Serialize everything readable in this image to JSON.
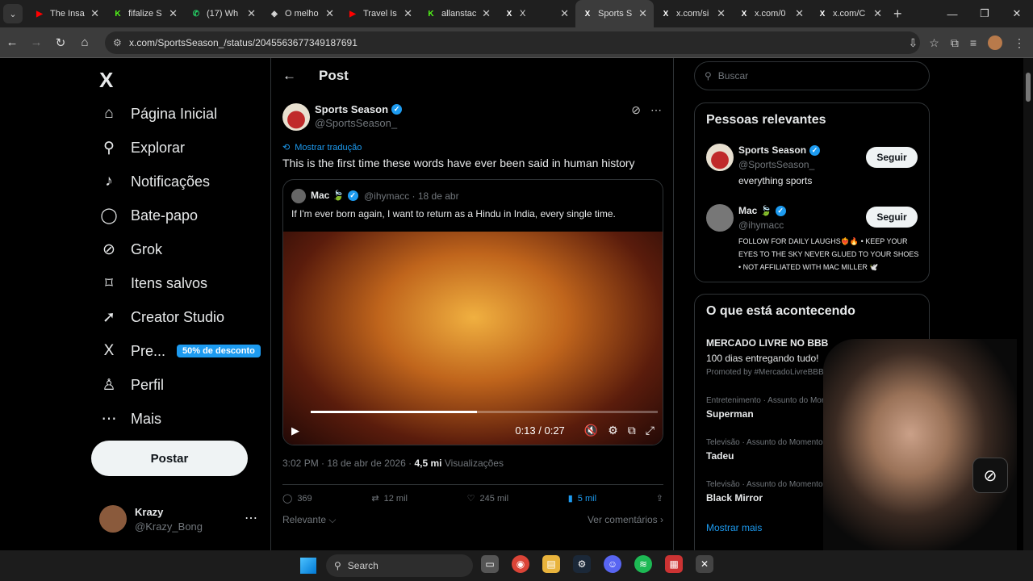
{
  "browser": {
    "tabs": [
      {
        "label": "The Insa",
        "fav": "▶",
        "color": "#ff0000"
      },
      {
        "label": "fifalize S",
        "fav": "K",
        "color": "#53fc18"
      },
      {
        "label": "(17) Wh",
        "fav": "✆",
        "color": "#25d366"
      },
      {
        "label": "O melho",
        "fav": "◈",
        "color": "#dddddd"
      },
      {
        "label": "Travel Is",
        "fav": "▶",
        "color": "#ff0000"
      },
      {
        "label": "allanstac",
        "fav": "K",
        "color": "#53fc18"
      },
      {
        "label": "X",
        "fav": "X",
        "color": "#ffffff"
      },
      {
        "label": "Sports S",
        "fav": "X",
        "color": "#ffffff"
      },
      {
        "label": "x.com/si",
        "fav": "X",
        "color": "#ffffff"
      },
      {
        "label": "x.com/0",
        "fav": "X",
        "color": "#ffffff"
      },
      {
        "label": "x.com/C",
        "fav": "X",
        "color": "#ffffff"
      }
    ],
    "url": "x.com/SportsSeason_/status/2045563677349187691"
  },
  "sidebar": {
    "logo": "X",
    "items": [
      {
        "label": "Página Inicial",
        "icon": "⌂"
      },
      {
        "label": "Explorar",
        "icon": "⚲"
      },
      {
        "label": "Notificações",
        "icon": "♪"
      },
      {
        "label": "Bate-papo",
        "icon": "◯"
      },
      {
        "label": "Grok",
        "icon": "⊘"
      },
      {
        "label": "Itens salvos",
        "icon": "⌑"
      },
      {
        "label": "Creator Studio",
        "icon": "➚"
      },
      {
        "label": "Pre...",
        "icon": "X"
      },
      {
        "label": "Perfil",
        "icon": "♙"
      },
      {
        "label": "Mais",
        "icon": "⋯"
      }
    ],
    "premium_badge": "50% de desconto",
    "post_button": "Postar",
    "user": {
      "name": "Krazy",
      "handle": "@Krazy_Bong"
    }
  },
  "main": {
    "header": "Post",
    "author": {
      "name": "Sports Season",
      "handle": "@SportsSeason_"
    },
    "translate_label": "Mostrar tradução",
    "text": "This is the first time these words have ever been said in human history",
    "quote": {
      "name": "Mac 🍃",
      "handle": "@ihymacc · 18 de abr",
      "text": "If I'm ever born again, I want to return as a Hindu in India, every single time.",
      "video_time": "0:13 / 0:27",
      "video_progress": 0.48
    },
    "meta_time": "3:02 PM · 18 de abr de 2026 · ",
    "views_count": "4,5 mi",
    "views_label": "Visualizações",
    "stats": {
      "replies": "369",
      "reposts": "12 mil",
      "likes": "245 mil",
      "bookmarks": "5 mil"
    },
    "sort_label": "Relevante ⌵",
    "comments_label": "Ver comentários ›"
  },
  "right": {
    "search_placeholder": "Buscar",
    "relevant_title": "Pessoas relevantes",
    "people": [
      {
        "name": "Sports Season",
        "handle": "@SportsSeason_",
        "bio": "everything sports",
        "button": "Seguir"
      },
      {
        "name": "Mac 🍃",
        "handle": "@ihymacc",
        "bio": "FOLLOW FOR DAILY LAUGHS❤️‍🔥🔥 • KEEP YOUR EYES TO THE SKY NEVER GLUED TO YOUR SHOES • NOT AFFILIATED WITH MAC MILLER 🕊️",
        "button": "Seguir"
      }
    ],
    "trends_title": "O que está acontecendo",
    "trends": [
      {
        "name": "MERCADO LIVRE NO BBB",
        "sub": "100 dias entregando tudo!",
        "promo": "Promoted by #MercadoLivreBBB26"
      },
      {
        "category": "Entretenimento · Assunto do Momento",
        "name": "Superman"
      },
      {
        "category": "Televisão · Assunto do Momento",
        "name": "Tadeu"
      },
      {
        "category": "Televisão · Assunto do Momento",
        "name": "Black Mirror"
      }
    ],
    "show_more": "Mostrar mais"
  },
  "taskbar": {
    "search_label": "Search"
  }
}
